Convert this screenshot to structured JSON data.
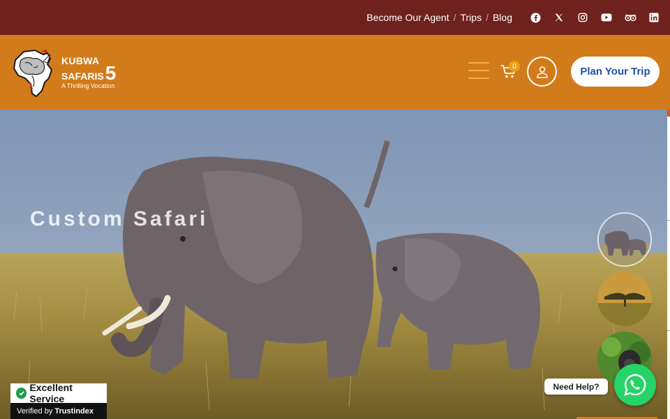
{
  "topbar": {
    "links": [
      "Become Our Agent",
      "Trips",
      "Blog"
    ],
    "separator": "/",
    "social_icons": [
      "facebook-icon",
      "x-twitter-icon",
      "instagram-icon",
      "youtube-icon",
      "tripadvisor-icon",
      "linkedin-icon"
    ]
  },
  "header": {
    "logo": {
      "line1": "KUBWA",
      "line2": "SAFARIS",
      "number": "5",
      "tagline": "A Thrilling Vocation"
    },
    "cart_count": "0",
    "plan_button": "Plan Your Trip"
  },
  "hero": {
    "title": "Custom Safari"
  },
  "trust_badge": {
    "title": "Excellent Service",
    "verified_prefix": "Verified by",
    "verified_brand": "Trustindex"
  },
  "help": {
    "label": "Need Help?"
  },
  "colors": {
    "topbar_bg": "#6e211d",
    "header_bg": "#d27b1a",
    "plan_button_text": "#2251a8",
    "whatsapp": "#25d366"
  }
}
